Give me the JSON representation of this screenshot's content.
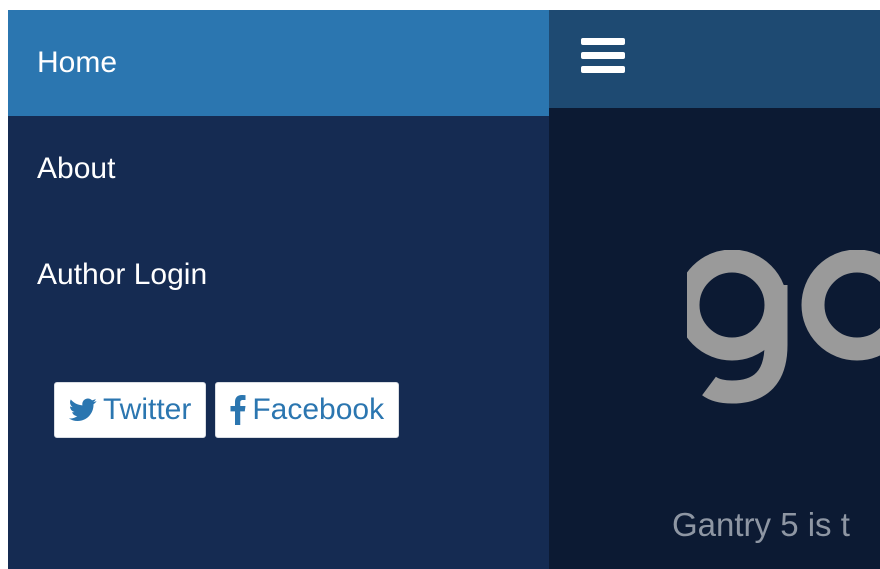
{
  "offcanvas_menu": {
    "items": [
      {
        "label": "Home",
        "active": true
      },
      {
        "label": "About",
        "active": false
      },
      {
        "label": "Author Login",
        "active": false
      }
    ],
    "social": [
      {
        "label": "Twitter",
        "icon": "twitter-icon"
      },
      {
        "label": "Facebook",
        "icon": "facebook-icon"
      }
    ]
  },
  "main": {
    "menu_icon": "hamburger-icon",
    "logo_text": "go",
    "tagline": "Gantry 5 is t"
  },
  "colors": {
    "menu_background": "#152b52",
    "active_item": "#2b76b0",
    "topbar": "#1e4a72",
    "page_background": "#0c1a33",
    "logo": "#9a9a9a",
    "tagline": "#8e96a3"
  }
}
